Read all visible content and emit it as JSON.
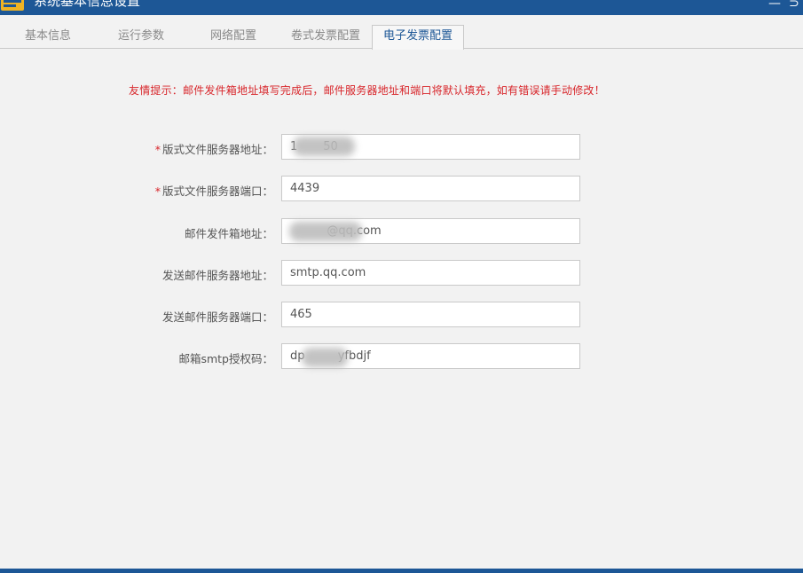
{
  "window": {
    "title": "系统基本信息设置",
    "minimize_glyph": "—",
    "close_glyph": "⊃"
  },
  "tabs": [
    {
      "label": "基本信息",
      "active": false
    },
    {
      "label": "运行参数",
      "active": false
    },
    {
      "label": "网络配置",
      "active": false
    },
    {
      "label": "卷式发票配置",
      "active": false
    },
    {
      "label": "电子发票配置",
      "active": true
    }
  ],
  "tip": "友情提示：邮件发件箱地址填写完成后，邮件服务器地址和端口将默认填充，如有错误请手动修改！",
  "form": {
    "fields": [
      {
        "label": "版式文件服务器地址：",
        "required": true,
        "value": "1       50"
      },
      {
        "label": "版式文件服务器端口：",
        "required": true,
        "value": "4439"
      },
      {
        "label": "邮件发件箱地址：",
        "required": false,
        "value": "          @qq.com"
      },
      {
        "label": "发送邮件服务器地址：",
        "required": false,
        "value": "smtp.qq.com"
      },
      {
        "label": "发送邮件服务器端口：",
        "required": false,
        "value": "465"
      },
      {
        "label": "邮箱smtp授权码：",
        "required": false,
        "value": "dp         yfbdjf"
      }
    ],
    "required_mark": "*"
  },
  "colors": {
    "titlebar": "#1d5796",
    "active_tab_text": "#1d5796",
    "tip_text": "#d8262b",
    "required_mark": "#d8262b"
  },
  "icons": {
    "app_logo": "app-logo-icon"
  }
}
